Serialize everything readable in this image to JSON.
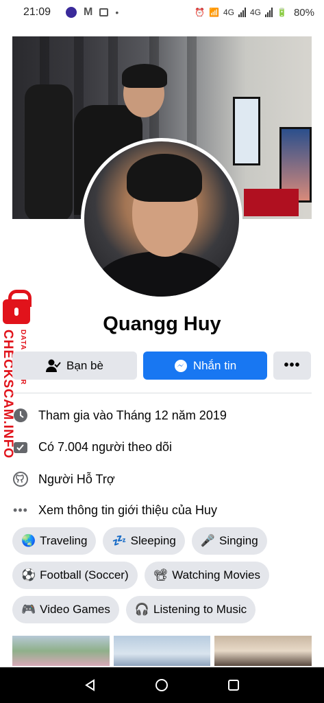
{
  "status_bar": {
    "time": "21:09",
    "network_labels": [
      "4G",
      "4G"
    ],
    "battery": "80%"
  },
  "profile": {
    "name": "Quangg Huy"
  },
  "actions": {
    "friends_label": "Bạn bè",
    "message_label": "Nhắn tin",
    "more_label": "•••"
  },
  "info": {
    "joined": "Tham gia vào Tháng 12 năm 2019",
    "followers": "Có 7.004 người theo dõi",
    "role": "Người Hỗ Trợ",
    "about_link": "Xem thông tin giới thiệu của Huy"
  },
  "hobbies": [
    {
      "emoji": "🌏",
      "label": "Traveling"
    },
    {
      "emoji": "💤",
      "label": "Sleeping"
    },
    {
      "emoji": "🎤",
      "label": "Singing"
    },
    {
      "emoji": "⚽",
      "label": "Football (Soccer)"
    },
    {
      "emoji": "📽",
      "label": "Watching Movies"
    },
    {
      "emoji": "🎮",
      "label": "Video Games"
    },
    {
      "emoji": "🎧",
      "label": "Listening to Music"
    }
  ],
  "watermark": {
    "brand": "CHECKSCAM.INFO",
    "sub": "DATA CENTER"
  },
  "colors": {
    "primary": "#1877f2",
    "button_gray": "#e4e6eb",
    "watermark_red": "#e1131b"
  }
}
